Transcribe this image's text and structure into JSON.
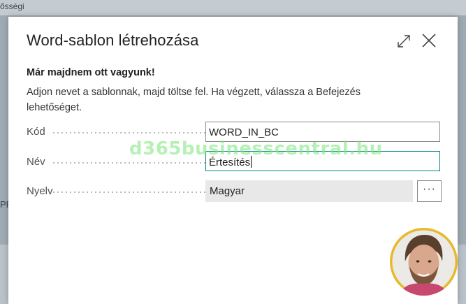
{
  "background": {
    "top_fragment": "ősségi",
    "left_fragment": "PR"
  },
  "dialog": {
    "title": "Word-sablon létrehozása",
    "heading": "Már majdnem ott vagyunk!",
    "description": "Adjon nevet a sablonnak, majd töltse fel. Ha végzett, válassza a Befejezés lehetőséget.",
    "fields": [
      {
        "label": "Kód",
        "value": "WORD_IN_BC"
      },
      {
        "label": "Név",
        "value": "Értesítés"
      },
      {
        "label": "Nyelv",
        "value": "Magyar"
      }
    ],
    "lookup_label": "···",
    "expand_icon": "expand-icon",
    "close_icon": "close-icon"
  },
  "watermark": "d365businesscentral.hu",
  "colors": {
    "accent": "#00838a",
    "avatar_ring": "#e7b92b"
  }
}
